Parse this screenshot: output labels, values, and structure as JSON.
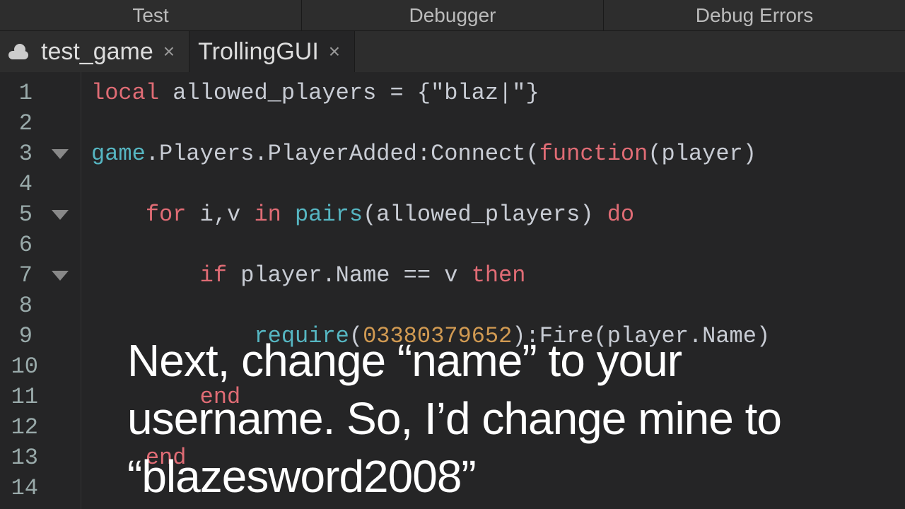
{
  "menu": {
    "test": "Test",
    "debugger": "Debugger",
    "debug_errors": "Debug Errors"
  },
  "tabs": {
    "tab1": {
      "name": "test_game"
    },
    "tab2": {
      "name": "TrollingGUI"
    }
  },
  "gutter": {
    "lines": [
      "1",
      "2",
      "3",
      "4",
      "5",
      "6",
      "7",
      "8",
      "9",
      "10",
      "11",
      "12",
      "13",
      "14"
    ]
  },
  "code": {
    "l1": {
      "kw": "local",
      "rest": " allowed_players = {",
      "str": "\"blaz|\"",
      "close": "}"
    },
    "l3": {
      "game": "game",
      "mid": ".Players.PlayerAdded:Connect(",
      "func": "function",
      "tail": "(player)"
    },
    "l5": {
      "pre": "    ",
      "for": "for",
      "mid": " i,v ",
      "in": "in",
      "sp": " ",
      "pairs": "pairs",
      "args": "(allowed_players) ",
      "do": "do"
    },
    "l7": {
      "pre": "        ",
      "if": "if",
      "mid": " player.Name == v ",
      "then": "then"
    },
    "l9": {
      "pre": "            ",
      "require": "require",
      "open": "(",
      "num": "03380379652",
      "close": "):Fire(player.Name)"
    },
    "l11": {
      "pre": "        ",
      "end": "end"
    },
    "l13": {
      "pre": "    ",
      "end": "end"
    }
  },
  "overlay": {
    "line1": "Next, change “name” to your",
    "line2": "username. So, I’d change mine to",
    "line3": "“blazesword2008”"
  }
}
